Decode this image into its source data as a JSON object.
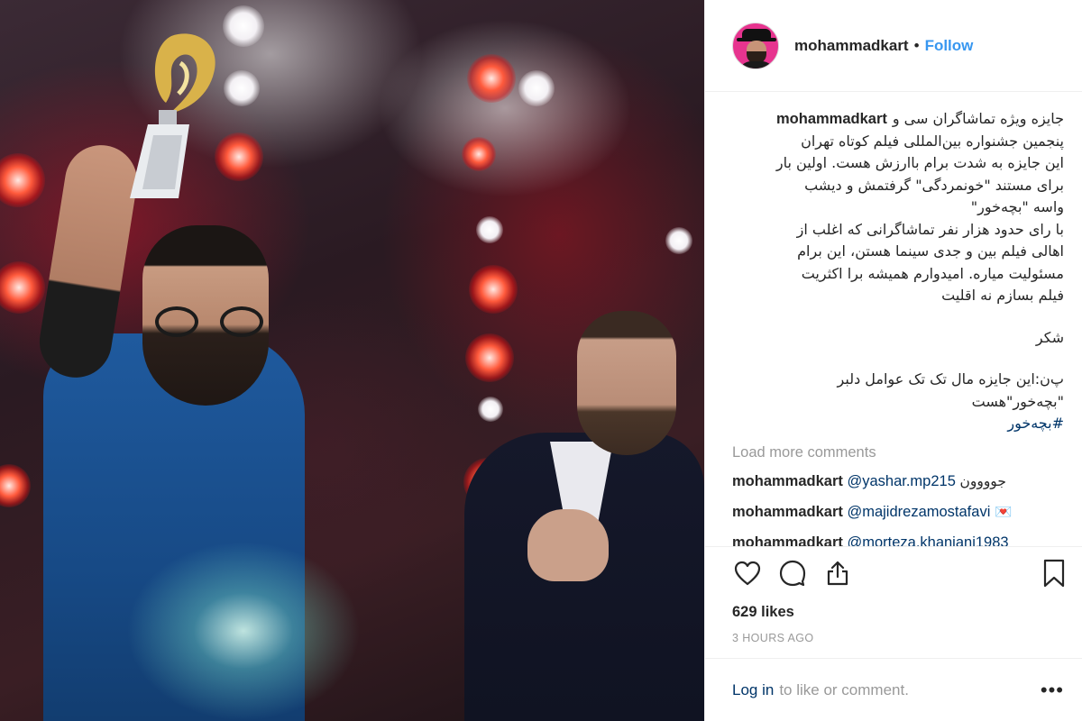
{
  "post": {
    "username": "mohammadkart",
    "separator": "•",
    "follow_label": "Follow",
    "caption_user": "mohammadkart",
    "caption_first_line": "جایزه ویژه تماشاگران سی و",
    "caption_lines": [
      "پنجمین جشنواره بین‌المللی فیلم کوتاه تهران",
      "این جایزه به شدت برام باارزش هست. اولین بار",
      "برای مستند \"خونمردگی\" گرفتمش و دیشب",
      "واسه \"بچه‌خور\"",
      "با رای حدود هزار نفر تماشاگرانی که اغلب از",
      "اهالی فیلم بین و جدی سینما هستن، این برام",
      "مسئولیت میاره. امیدوارم همیشه برا اکثریت",
      "فیلم بسازم نه اقلیت"
    ],
    "caption_thanks": "شکر",
    "caption_ps_lines": [
      "پ‌ن:این جایزه مال تک تک عوامل دلبر",
      "\"بچه‌خور\"هست"
    ],
    "caption_hashtag": "#بچه‌خور",
    "load_more_label": "Load more comments",
    "comments": [
      {
        "user": "mohammadkart",
        "mention": "@yashar.mp215",
        "text": "جوووون"
      },
      {
        "user": "mohammadkart",
        "mention": "@majidrezamostafavi",
        "text": "💌"
      },
      {
        "user": "mohammadkart",
        "mention": "@morteza.khanjani1983",
        "text": ""
      }
    ],
    "likes_text": "629 likes",
    "time_text": "3 HOURS AGO",
    "login_label": "Log in",
    "login_rest": "to like or comment.",
    "more_label": "•••"
  },
  "icons": {
    "like": "heart-icon",
    "comment": "comment-icon",
    "share": "share-icon",
    "save": "bookmark-icon",
    "more": "more-options-icon"
  },
  "colors": {
    "link_blue": "#3897f0",
    "mention_blue": "#003569",
    "muted_gray": "#999999",
    "text": "#262626",
    "avatar_bg": "#e7348f"
  }
}
